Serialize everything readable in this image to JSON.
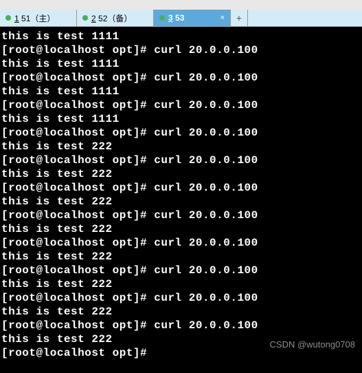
{
  "titlebar": {
    "text": ""
  },
  "tabs": {
    "items": [
      {
        "num": "1",
        "label": " 51（主）",
        "active": false
      },
      {
        "num": "2",
        "label": " 52（备）",
        "active": false
      },
      {
        "num": "3",
        "label": " 53",
        "active": true,
        "close": "×"
      }
    ],
    "new_tab": "+"
  },
  "terminal": {
    "lines": [
      "this is test 1111",
      "[root@localhost opt]# curl 20.0.0.100",
      "this is test 1111",
      "[root@localhost opt]# curl 20.0.0.100",
      "this is test 1111",
      "[root@localhost opt]# curl 20.0.0.100",
      "this is test 1111",
      "[root@localhost opt]# curl 20.0.0.100",
      "this is test 222",
      "[root@localhost opt]# curl 20.0.0.100",
      "this is test 222",
      "[root@localhost opt]# curl 20.0.0.100",
      "this is test 222",
      "[root@localhost opt]# curl 20.0.0.100",
      "this is test 222",
      "[root@localhost opt]# curl 20.0.0.100",
      "this is test 222",
      "[root@localhost opt]# curl 20.0.0.100",
      "this is test 222",
      "[root@localhost opt]# curl 20.0.0.100",
      "this is test 222",
      "[root@localhost opt]# curl 20.0.0.100",
      "this is test 222",
      "[root@localhost opt]#"
    ]
  },
  "watermark": {
    "text": "CSDN @wutong0708"
  }
}
